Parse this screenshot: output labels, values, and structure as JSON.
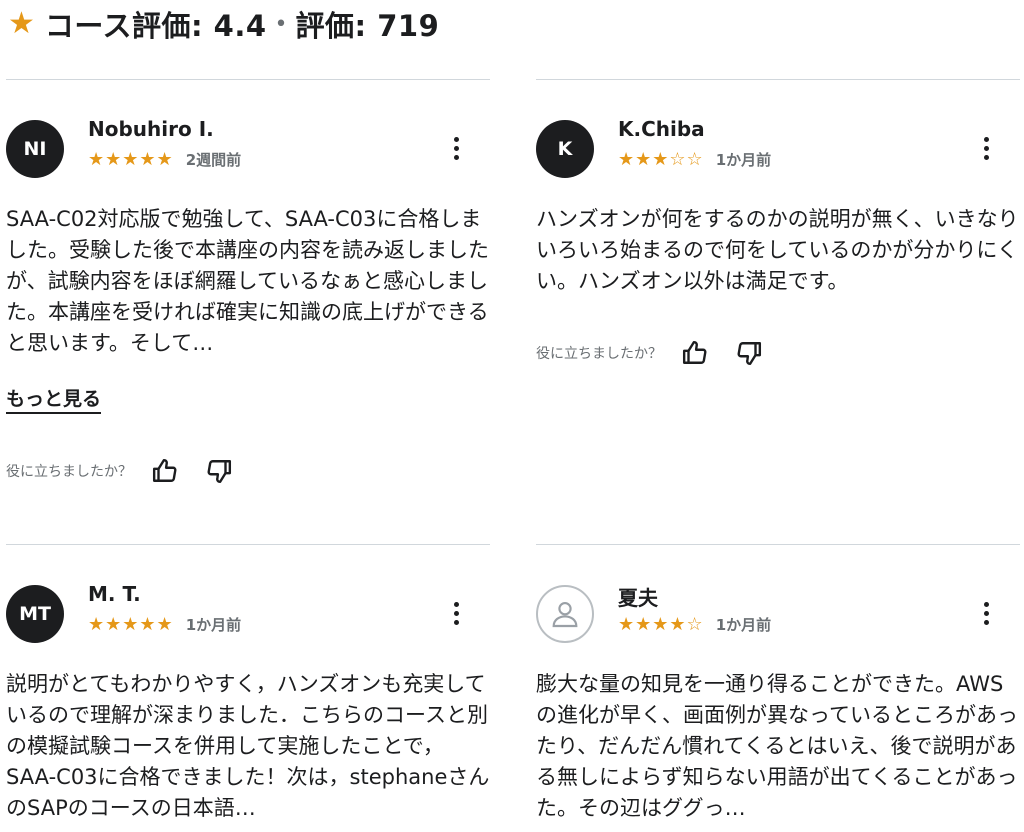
{
  "header": {
    "star_icon": "star-icon",
    "course_rating": "コース評価: 4.4",
    "separator": "•",
    "review_count": "評価: 719"
  },
  "colors": {
    "star": "#e59819",
    "text": "#1c1d1f",
    "muted": "#6a6f73",
    "divider": "#d1d7dc"
  },
  "helpful_label": "役に立ちましたか？",
  "reviews": [
    {
      "initials": "NI",
      "name": "Nobuhiro I.",
      "stars": "★★★★★",
      "rating": 5,
      "date": "2週間前",
      "text": "SAA-C02対応版で勉強して、SAA-C03に合格しました。受験した後で本講座の内容を読み返しましたが、試験内容をほぼ網羅しているなぁと感心しました。本講座を受ければ確実に知識の底上げができると思います。そして…",
      "more": "もっと見る"
    },
    {
      "initials": "K",
      "name": "K.Chiba",
      "stars": "★★★☆☆",
      "rating": 3,
      "date": "1か月前",
      "text": "ハンズオンが何をするのかの説明が無く、いきなりいろいろ始まるので何をしているのかが分かりにくい。ハンズオン以外は満足です。"
    },
    {
      "initials": "MT",
      "name": "M. T.",
      "stars": "★★★★★",
      "rating": 5,
      "date": "1か月前",
      "text": "説明がとてもわかりやすく，ハンズオンも充実しているので理解が深まりました．こちらのコースと別の模擬試験コースを併用して実施したことで，SAA-C03に合格できました！次は，stephaneさんのSAPのコースの日本語…"
    },
    {
      "initials": "",
      "avatar_icon": "user-icon",
      "name": "夏夫",
      "stars": "★★★★☆",
      "rating": 4,
      "date": "1か月前",
      "text": "膨大な量の知見を一通り得ることができた。AWSの進化が早く、画面例が異なっているところがあったり、だんだん慣れてくるとはいえ、後で説明がある無しによらず知らない用語が出てくることがあった。その辺はググっ…"
    }
  ]
}
